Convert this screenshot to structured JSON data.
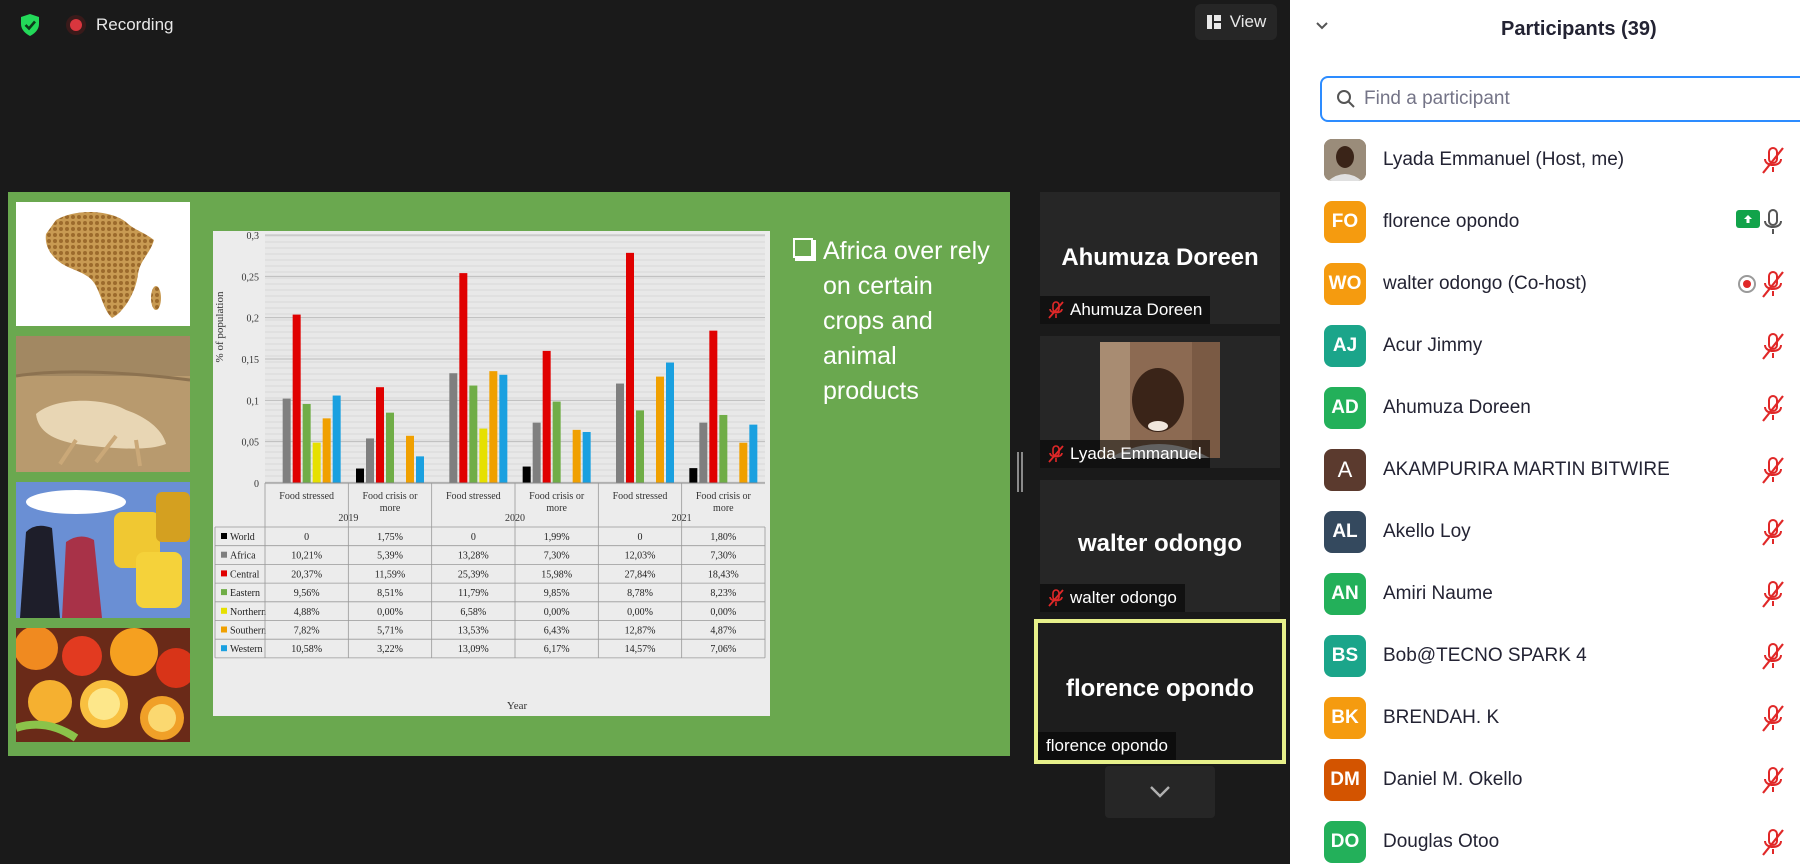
{
  "topbar": {
    "recording_label": "Recording",
    "view_label": "View",
    "colors": {
      "shield": "#23d959",
      "record": "#d9363e"
    }
  },
  "slide": {
    "bullet_text": "Africa over rely on certain crops and animal products",
    "background": "#6aa84f",
    "images": [
      "grain-africa-map",
      "dead-camel-drought",
      "women-water-containers",
      "fruits-vegetables"
    ]
  },
  "chart_data": {
    "type": "bar",
    "ylabel": "% of population",
    "xlabel": "Year",
    "ylim": [
      0,
      0.3
    ],
    "yticks": [
      "0",
      "0,05",
      "0,1",
      "0,15",
      "0,2",
      "0,25",
      "0,3"
    ],
    "groups": [
      {
        "year": "2019",
        "categories": [
          "Food stressed",
          "Food crisis or more"
        ]
      },
      {
        "year": "2020",
        "categories": [
          "Food stressed",
          "Food crisis or more"
        ]
      },
      {
        "year": "2021",
        "categories": [
          "Food stressed",
          "Food crisis or more"
        ]
      }
    ],
    "series": [
      {
        "name": "World",
        "color": "#000000",
        "values": [
          0,
          0.0175,
          0,
          0.0199,
          0,
          0.018
        ],
        "labels": [
          "0",
          "1,75%",
          "0",
          "1,99%",
          "0",
          "1,80%"
        ]
      },
      {
        "name": "Africa",
        "color": "#7f7f7f",
        "values": [
          0.1021,
          0.0539,
          0.1328,
          0.073,
          0.1203,
          0.073
        ],
        "labels": [
          "10,21%",
          "5,39%",
          "13,28%",
          "7,30%",
          "12,03%",
          "7,30%"
        ]
      },
      {
        "name": "Central",
        "color": "#e00000",
        "values": [
          0.2037,
          0.1159,
          0.2539,
          0.1598,
          0.2784,
          0.1843
        ],
        "labels": [
          "20,37%",
          "11,59%",
          "25,39%",
          "15,98%",
          "27,84%",
          "18,43%"
        ]
      },
      {
        "name": "Eastern",
        "color": "#70ad47",
        "values": [
          0.0956,
          0.0851,
          0.1179,
          0.0985,
          0.0878,
          0.0823
        ],
        "labels": [
          "9,56%",
          "8,51%",
          "11,79%",
          "9,85%",
          "8,78%",
          "8,23%"
        ]
      },
      {
        "name": "Northern",
        "color": "#e6e000",
        "values": [
          0.0488,
          0,
          0.0658,
          0,
          0,
          0
        ],
        "labels": [
          "4,88%",
          "0,00%",
          "6,58%",
          "0,00%",
          "0,00%",
          "0,00%"
        ]
      },
      {
        "name": "Southern",
        "color": "#f0a000",
        "values": [
          0.0782,
          0.0571,
          0.1353,
          0.0643,
          0.1287,
          0.0487
        ],
        "labels": [
          "7,82%",
          "5,71%",
          "13,53%",
          "6,43%",
          "12,87%",
          "4,87%"
        ]
      },
      {
        "name": "Western",
        "color": "#1aa0e0",
        "values": [
          0.1058,
          0.0322,
          0.1309,
          0.0617,
          0.1457,
          0.0706
        ],
        "labels": [
          "10,58%",
          "3,22%",
          "13,09%",
          "6,17%",
          "14,57%",
          "7,06%"
        ]
      }
    ]
  },
  "tiles": [
    {
      "big_name": "Ahumuza Doreen",
      "tag": "Ahumuza Doreen",
      "muted": true
    },
    {
      "big_name": "",
      "tag": "Lyada Emmanuel",
      "muted": true
    },
    {
      "big_name": "walter odongo",
      "tag": "walter odongo",
      "muted": true
    },
    {
      "big_name": "florence opondo",
      "tag": "florence opondo",
      "muted": false
    }
  ],
  "panel": {
    "title": "Participants (39)",
    "search_placeholder": "Find a participant",
    "participants": [
      {
        "name": "Lyada Emmanuel (Host, me)",
        "initials": "",
        "color": "#8a6a4a",
        "mic": "muted",
        "photo": true
      },
      {
        "name": "florence opondo",
        "initials": "FO",
        "color": "#f59b0f",
        "mic": "on",
        "sharing": true
      },
      {
        "name": "walter odongo (Co-host)",
        "initials": "WO",
        "color": "#f59b0f",
        "mic": "muted",
        "recording": true
      },
      {
        "name": "Acur Jimmy",
        "initials": "AJ",
        "color": "#1ba58a",
        "mic": "muted"
      },
      {
        "name": "Ahumuza Doreen",
        "initials": "AD",
        "color": "#23b05a",
        "mic": "muted"
      },
      {
        "name": "AKAMPURIRA MARTIN BITWIRE",
        "initials": "A",
        "color": "#5b3a2e",
        "mic": "muted"
      },
      {
        "name": "Akello Loy",
        "initials": "AL",
        "color": "#34495e",
        "mic": "muted"
      },
      {
        "name": "Amiri Naume",
        "initials": "AN",
        "color": "#23b05a",
        "mic": "muted"
      },
      {
        "name": "Bob@TECNO SPARK 4",
        "initials": "BS",
        "color": "#1ba58a",
        "mic": "muted"
      },
      {
        "name": "BRENDAH. K",
        "initials": "BK",
        "color": "#f59b0f",
        "mic": "muted"
      },
      {
        "name": "Daniel M. Okello",
        "initials": "DM",
        "color": "#d35400",
        "mic": "muted"
      },
      {
        "name": "Douglas Otoo",
        "initials": "DO",
        "color": "#23b05a",
        "mic": "muted"
      }
    ]
  }
}
